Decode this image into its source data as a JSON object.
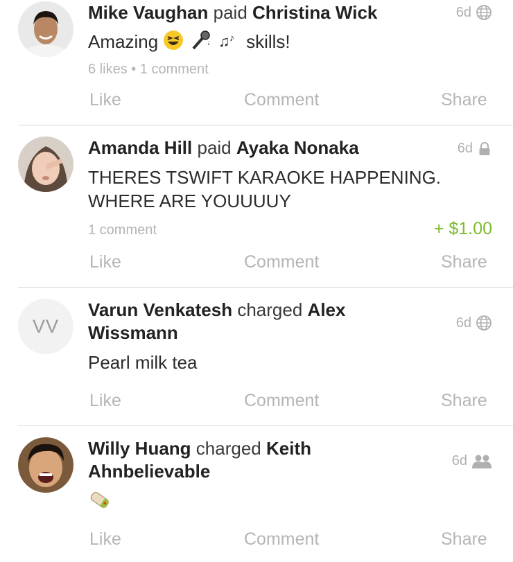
{
  "stories": [
    {
      "actor": "Mike Vaughan",
      "verb": "paid",
      "target": "Christina Wick",
      "time": "6d",
      "privacy_icon": "globe-icon",
      "message_text": "skills!",
      "message_emoji": [
        "grinning-squinting-face",
        "microphone",
        "musical-notes"
      ],
      "meta": "6 likes • 1 comment",
      "amount": "",
      "actions": {
        "like": "Like",
        "comment": "Comment",
        "share": "Share"
      }
    },
    {
      "actor": "Amanda Hill",
      "verb": "paid",
      "target": "Ayaka Nonaka",
      "time": "6d",
      "privacy_icon": "lock-icon",
      "message_text": "THERES TSWIFT KARAOKE HAPPENING. WHERE ARE YOUUUUY",
      "meta": "1 comment",
      "amount": "+ $1.00",
      "amount_color": "#7cbb2a",
      "actions": {
        "like": "Like",
        "comment": "Comment",
        "share": "Share"
      }
    },
    {
      "actor": "Varun Venkatesh",
      "verb": "charged",
      "target": "Alex Wissmann",
      "avatar_initials": "VV",
      "time": "6d",
      "privacy_icon": "globe-icon",
      "message_text": "Pearl milk tea",
      "meta": "",
      "amount": "",
      "actions": {
        "like": "Like",
        "comment": "Comment",
        "share": "Share"
      }
    },
    {
      "actor": "Willy Huang",
      "verb": "charged",
      "target": "Keith Ahnbelievable",
      "time": "6d",
      "privacy_icon": "friends-icon",
      "message_emoji": [
        "burrito"
      ],
      "meta": "",
      "amount": "",
      "actions": {
        "like": "Like",
        "comment": "Comment",
        "share": "Share"
      }
    }
  ]
}
